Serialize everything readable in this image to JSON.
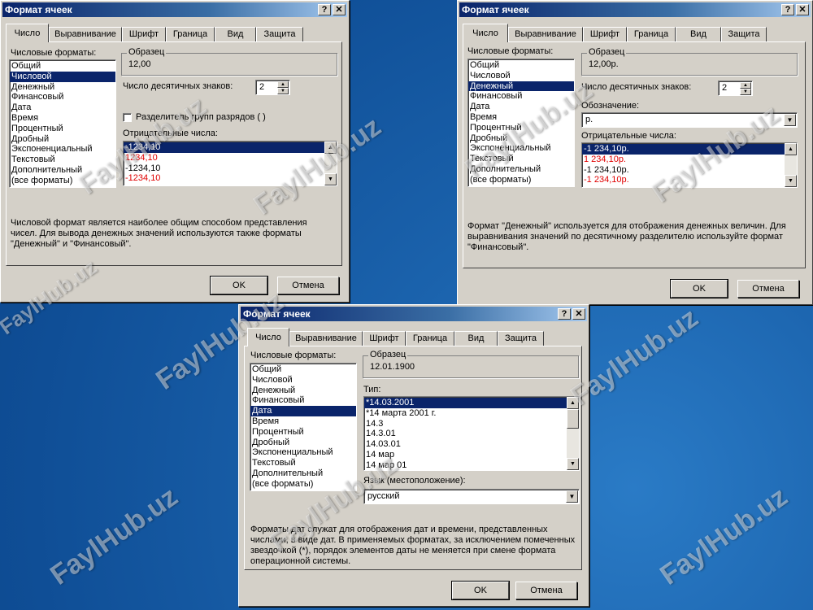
{
  "watermark": "FaylHub.uz",
  "dialogs": {
    "d1": {
      "title": "Формат ячеек",
      "tabs": [
        "Число",
        "Выравнивание",
        "Шрифт",
        "Граница",
        "Вид",
        "Защита"
      ],
      "formats_label": "Числовые форматы:",
      "formats": [
        "Общий",
        "Числовой",
        "Денежный",
        "Финансовый",
        "Дата",
        "Время",
        "Процентный",
        "Дробный",
        "Экспоненциальный",
        "Текстовый",
        "Дополнительный",
        "(все форматы)"
      ],
      "selected_format": "Числовой",
      "sample_label": "Образец",
      "sample_value": "12,00",
      "decimals_label": "Число десятичных знаков:",
      "decimals_value": "2",
      "separator_label": "Разделитель групп разрядов ( )",
      "negatives_label": "Отрицательные числа:",
      "negatives": [
        "-1234,10",
        "1234,10",
        "-1234,10",
        "-1234,10"
      ],
      "description": "Числовой формат является наиболее общим способом представления чисел. Для вывода денежных значений используются также форматы \"Денежный\" и \"Финансовый\".",
      "ok": "OK",
      "cancel": "Отмена"
    },
    "d2": {
      "title": "Формат ячеек",
      "tabs": [
        "Число",
        "Выравнивание",
        "Шрифт",
        "Граница",
        "Вид",
        "Защита"
      ],
      "formats_label": "Числовые форматы:",
      "formats": [
        "Общий",
        "Числовой",
        "Денежный",
        "Финансовый",
        "Дата",
        "Время",
        "Процентный",
        "Дробный",
        "Экспоненциальный",
        "Текстовый",
        "Дополнительный",
        "(все форматы)"
      ],
      "selected_format": "Денежный",
      "sample_label": "Образец",
      "sample_value": "12,00р.",
      "decimals_label": "Число десятичных знаков:",
      "decimals_value": "2",
      "symbol_label": "Обозначение:",
      "symbol_value": "р.",
      "negatives_label": "Отрицательные числа:",
      "negatives": [
        "-1 234,10р.",
        "1 234,10р.",
        "-1 234,10р.",
        "-1 234,10р."
      ],
      "description": "Формат \"Денежный\" используется для отображения денежных величин. Для выравнивания значений по десятичному разделителю используйте формат \"Финансовый\".",
      "ok": "OK",
      "cancel": "Отмена"
    },
    "d3": {
      "title": "Формат ячеек",
      "tabs": [
        "Число",
        "Выравнивание",
        "Шрифт",
        "Граница",
        "Вид",
        "Защита"
      ],
      "formats_label": "Числовые форматы:",
      "formats": [
        "Общий",
        "Числовой",
        "Денежный",
        "Финансовый",
        "Дата",
        "Время",
        "Процентный",
        "Дробный",
        "Экспоненциальный",
        "Текстовый",
        "Дополнительный",
        "(все форматы)"
      ],
      "selected_format": "Дата",
      "sample_label": "Образец",
      "sample_value": "12.01.1900",
      "type_label": "Тип:",
      "types": [
        "*14.03.2001",
        "*14 марта 2001 г.",
        "14.3",
        "14.3.01",
        "14.03.01",
        "14 мар",
        "14 мар 01"
      ],
      "lang_label": "Язык (местоположение):",
      "lang_value": "русский",
      "description": "Форматы дат служат для отображения дат и времени, представленных числами, в виде дат. В применяемых форматах, за исключением помеченных звездочкой (*), порядок элементов даты не меняется при смене формата операционной системы.",
      "ok": "OK",
      "cancel": "Отмена"
    }
  },
  "colors": {
    "selection": "#0a246a",
    "negative_red": "#e00000",
    "dialog_face": "#d4d0c8"
  }
}
